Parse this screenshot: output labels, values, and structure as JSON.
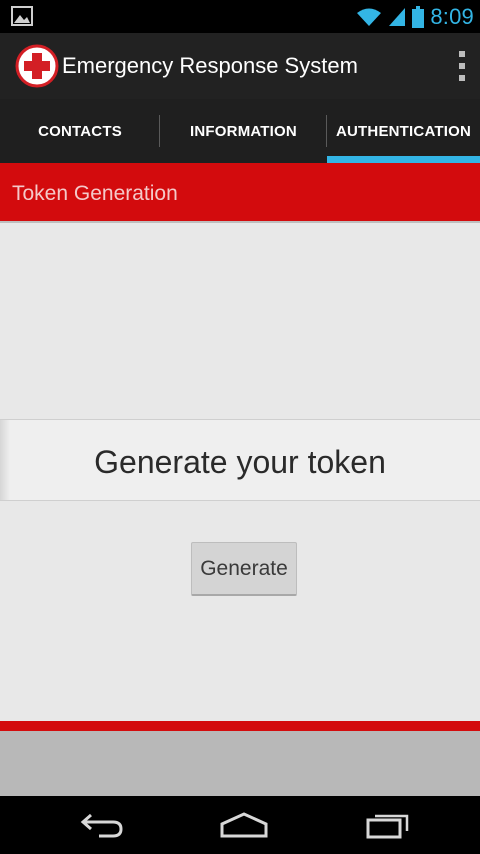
{
  "status_bar": {
    "time": "8:09",
    "icons": [
      "image-notification-icon",
      "wifi-icon",
      "cell-signal-icon",
      "battery-icon"
    ]
  },
  "action_bar": {
    "title": "Emergency Response System",
    "app_icon": "red-cross-icon",
    "overflow_icon": "overflow-menu-icon"
  },
  "tabs": [
    {
      "label": "CONTACTS",
      "selected": false
    },
    {
      "label": "INFORMATION",
      "selected": false
    },
    {
      "label": "AUTHENTICATION",
      "selected": true
    }
  ],
  "section": {
    "header": "Token Generation"
  },
  "token": {
    "banner_text": "Generate your token",
    "button_label": "Generate"
  },
  "nav_bar": {
    "buttons": [
      "back-icon",
      "home-icon",
      "recents-icon"
    ]
  },
  "colors": {
    "accent": "#33b5e5",
    "brand_red": "#d30b0d",
    "action_bar": "#222222",
    "background": "#e8e8e8"
  }
}
